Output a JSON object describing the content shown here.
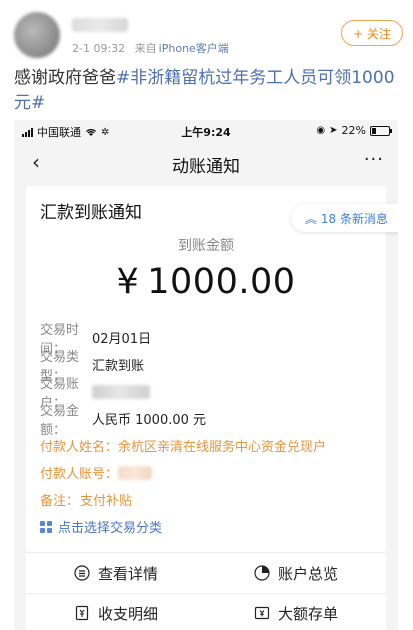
{
  "post": {
    "timestamp": "2-1 09:32",
    "source_prefix": "来自",
    "source": "iPhone客户端",
    "follow_label": "+ 关注",
    "text_plain": "感谢政府爸爸",
    "topic": "#非浙籍留杭过年务工人员可领1000元#"
  },
  "statusbar": {
    "carrier": "中国联通",
    "time": "上午9:24",
    "battery": "22%"
  },
  "nav": {
    "back_symbol": "‹",
    "title": "动账通知",
    "more_symbol": "···"
  },
  "card": {
    "title": "汇款到账通知",
    "new_messages": "18 条新消息",
    "amount_label": "到账金额",
    "currency_symbol": "¥",
    "amount": "1000.00",
    "rows": [
      {
        "key": "交易时间：",
        "value": "02月01日"
      },
      {
        "key": "交易类型：",
        "value": "汇款到账"
      },
      {
        "key": "交易账户：",
        "value": ""
      },
      {
        "key": "交易金额：",
        "value": "人民币 1000.00 元"
      },
      {
        "key": "付款人姓名：",
        "value": "余杭区亲清在线服务中心资金兑现户"
      },
      {
        "key": "付款人账号：",
        "value": ""
      },
      {
        "key": "备注：",
        "value": "支付补贴"
      }
    ],
    "classify_label": "点击选择交易分类"
  },
  "actions": {
    "details": "查看详情",
    "overview": "账户总览",
    "statement": "收支明细",
    "deposit": "大额存单"
  },
  "colors": {
    "accent_orange": "#e8943b",
    "link_blue": "#4a73c8",
    "topic_blue": "#4e6fb5"
  }
}
